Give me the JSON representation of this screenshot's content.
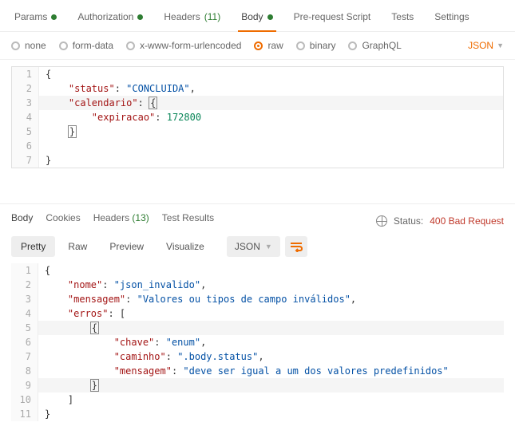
{
  "topTabs": {
    "params": "Params",
    "authorization": "Authorization",
    "headersLabel": "Headers",
    "headersCount": "(11)",
    "body": "Body",
    "prerequest": "Pre-request Script",
    "tests": "Tests",
    "settings": "Settings"
  },
  "bodyOpts": {
    "none": "none",
    "formdata": "form-data",
    "xwww": "x-www-form-urlencoded",
    "raw": "raw",
    "binary": "binary",
    "graphql": "GraphQL",
    "lang": "JSON"
  },
  "reqBody": {
    "l1": "{",
    "l2_key": "\"status\"",
    "l2_val": "\"CONCLUIDA\"",
    "l3_key": "\"calendario\"",
    "l3_brace": "{",
    "l4_key": "\"expiracao\"",
    "l4_val": "172800",
    "l5": "}",
    "l7": "}"
  },
  "respTabs": {
    "body": "Body",
    "cookies": "Cookies",
    "headersLabel": "Headers",
    "headersCount": "(13)",
    "testResults": "Test Results"
  },
  "respStatus": {
    "label": "Status:",
    "value": "400 Bad Request"
  },
  "viewBar": {
    "pretty": "Pretty",
    "raw": "Raw",
    "preview": "Preview",
    "visualize": "Visualize",
    "fmt": "JSON"
  },
  "respBody": {
    "l1": "{",
    "l2_key": "\"nome\"",
    "l2_val": "\"json_invalido\"",
    "l3_key": "\"mensagem\"",
    "l3_val": "\"Valores ou tipos de campo inválidos\"",
    "l4_key": "\"erros\"",
    "l5_brace": "{",
    "l6_key": "\"chave\"",
    "l6_val": "\"enum\"",
    "l7_key": "\"caminho\"",
    "l7_val": "\".body.status\"",
    "l8_key": "\"mensagem\"",
    "l8_val": "\"deve ser igual a um dos valores predefinidos\"",
    "l9_brace": "}",
    "l10": "]",
    "l11": "}"
  }
}
